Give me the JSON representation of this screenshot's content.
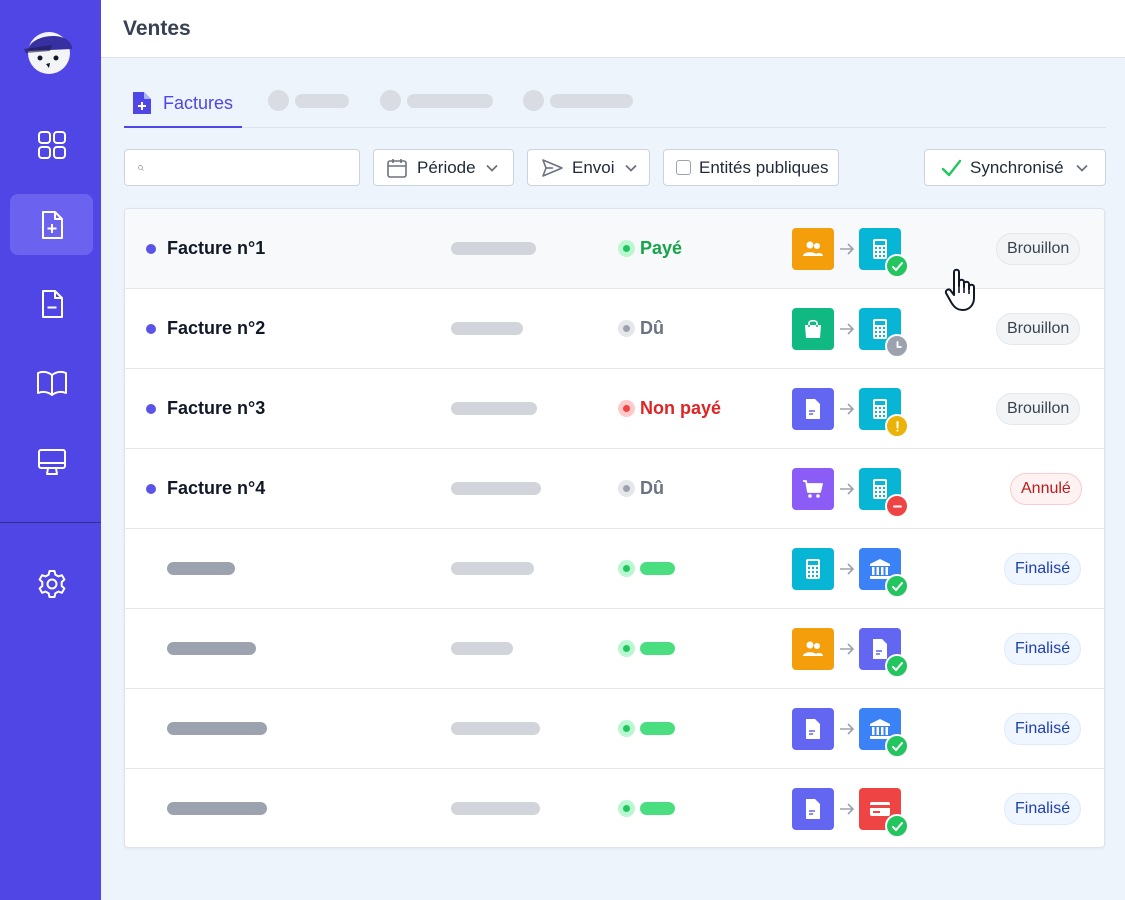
{
  "header": {
    "title": "Ventes"
  },
  "tabs": {
    "active_label": "Factures"
  },
  "toolbar": {
    "search_placeholder": "",
    "period_label": "Période",
    "send_label": "Envoi",
    "public_entities_label": "Entités publiques",
    "sync_label": "Synchronisé"
  },
  "rows": [
    {
      "name": "Facture n°1",
      "status": "Payé",
      "status_kind": "paid",
      "source_icon": "users-icon",
      "dest_icon": "calculator-icon",
      "sync_state": "check-icon",
      "state": "Brouillon",
      "state_kind": "draft"
    },
    {
      "name": "Facture n°2",
      "status": "Dû",
      "status_kind": "due",
      "source_icon": "shopping-bag-icon",
      "dest_icon": "calculator-icon",
      "sync_state": "clock-icon",
      "state": "Brouillon",
      "state_kind": "draft"
    },
    {
      "name": "Facture n°3",
      "status": "Non payé",
      "status_kind": "unpaid",
      "source_icon": "document-icon",
      "dest_icon": "calculator-icon",
      "sync_state": "warning-icon",
      "state": "Brouillon",
      "state_kind": "draft"
    },
    {
      "name": "Facture n°4",
      "status": "Dû",
      "status_kind": "due",
      "source_icon": "cart-icon",
      "dest_icon": "calculator-icon",
      "sync_state": "minus-icon",
      "state": "Annulé",
      "state_kind": "cancelled"
    },
    {
      "source_icon": "calculator-icon",
      "dest_icon": "bank-icon",
      "sync_state": "check-icon",
      "state": "Finalisé",
      "state_kind": "final"
    },
    {
      "source_icon": "users-icon",
      "dest_icon": "document-icon",
      "sync_state": "check-icon",
      "state": "Finalisé",
      "state_kind": "final"
    },
    {
      "source_icon": "document-icon",
      "dest_icon": "bank-icon",
      "sync_state": "check-icon",
      "state": "Finalisé",
      "state_kind": "final"
    },
    {
      "source_icon": "document-icon",
      "dest_icon": "credit-card-icon",
      "sync_state": "check-icon",
      "state": "Finalisé",
      "state_kind": "final"
    }
  ],
  "colors": {
    "brand": "#4f46e5",
    "paid": "#16a34a",
    "due": "#6b7280",
    "unpaid": "#dc2626",
    "draft_pill": "#f3f4f6",
    "cancelled_pill": "#fef2f2",
    "final_pill": "#eff6ff"
  }
}
